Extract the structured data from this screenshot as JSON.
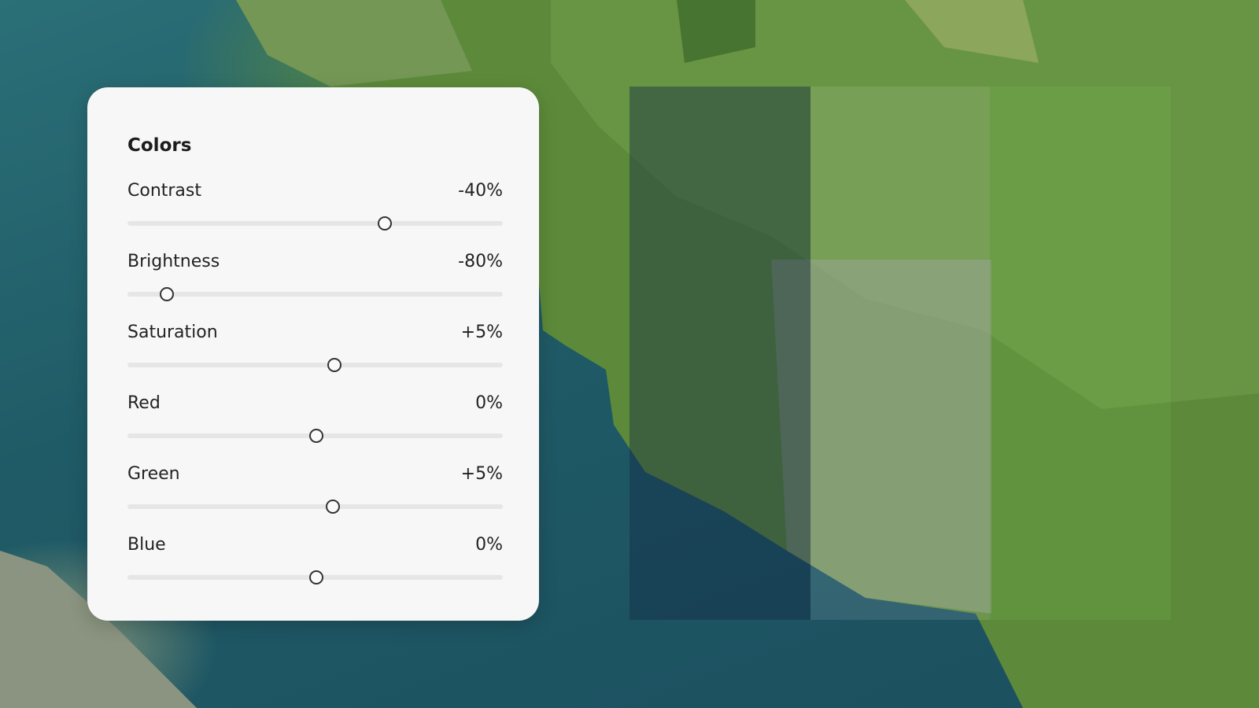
{
  "panel": {
    "title": "Colors",
    "sliders": [
      {
        "label": "Contrast",
        "value": "-40%",
        "position": 0.685
      },
      {
        "label": "Brightness",
        "value": "-80%",
        "position": 0.105
      },
      {
        "label": "Saturation",
        "value": "+5%",
        "position": 0.552
      },
      {
        "label": "Red",
        "value": "0%",
        "position": 0.503
      },
      {
        "label": "Green",
        "value": "+5%",
        "position": 0.548
      },
      {
        "label": "Blue",
        "value": "0%",
        "position": 0.503
      }
    ]
  }
}
